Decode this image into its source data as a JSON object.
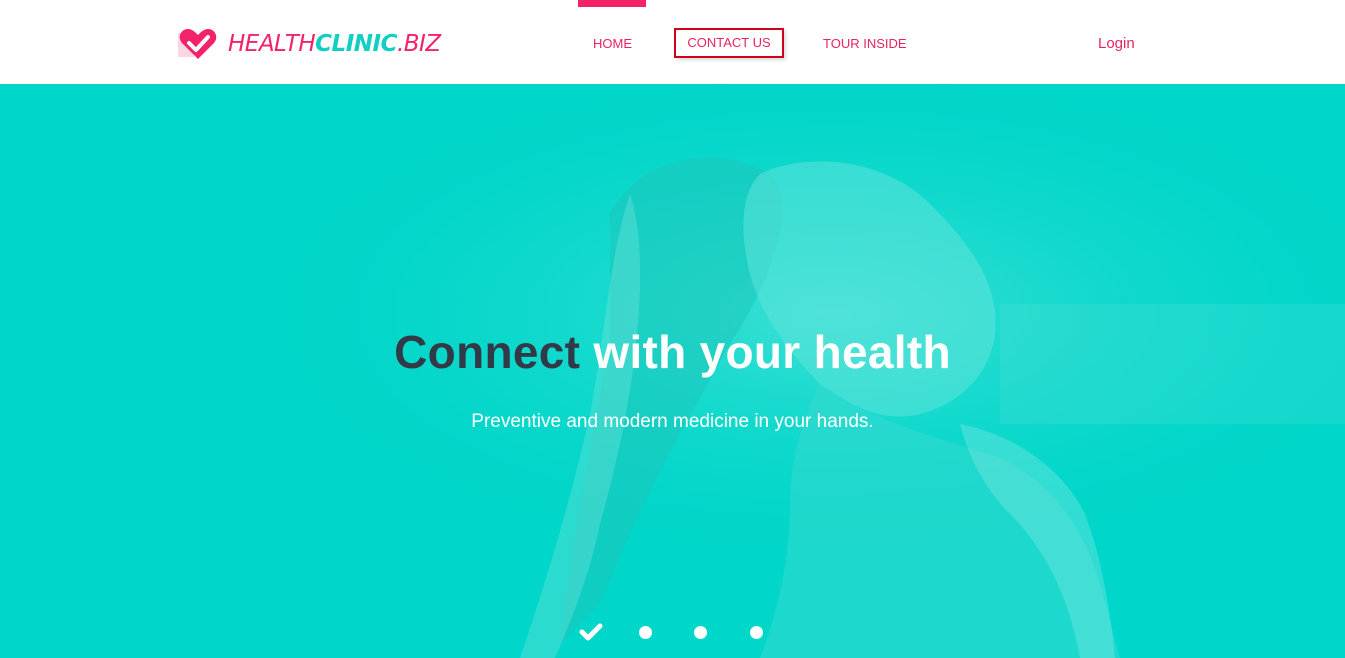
{
  "header": {
    "logo": {
      "part1": "HEALTH",
      "part2": "CLINIC",
      "part3": ".BIZ"
    },
    "nav": [
      {
        "label": "HOME"
      },
      {
        "label": "CONTACT US"
      },
      {
        "label": "TOUR INSIDE"
      }
    ],
    "login_label": "Login"
  },
  "hero": {
    "headline_dark": "Connect",
    "headline_light": "with your health",
    "subtitle": "Preventive and modern medicine in your hands."
  },
  "colors": {
    "brand_pink": "#f4216b",
    "brand_teal": "#12cfc4",
    "hero_bg": "#00d6c9",
    "headline_dark": "#333a47",
    "highlight_border": "#d0021b"
  },
  "carousel": {
    "icons": [
      "check-icon",
      "dot",
      "dot",
      "dot"
    ]
  }
}
